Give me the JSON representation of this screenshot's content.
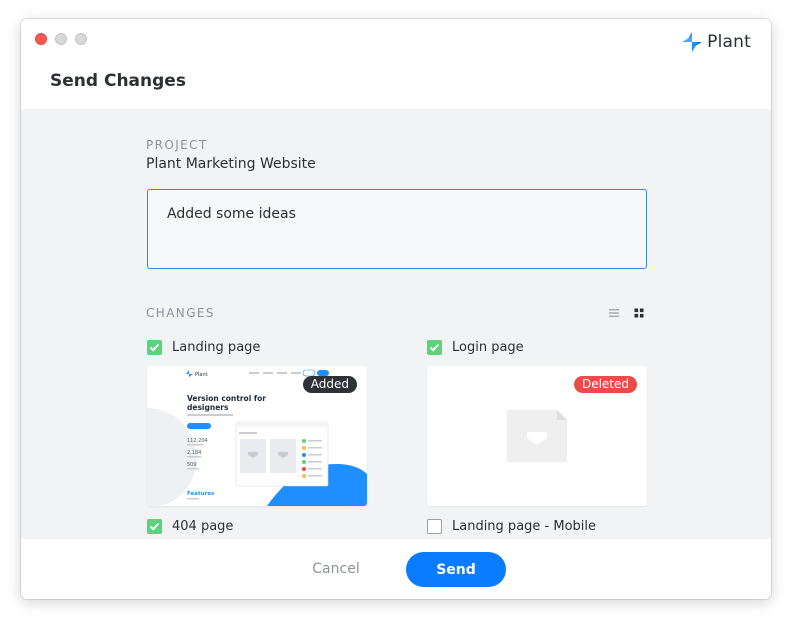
{
  "brand": {
    "name": "Plant",
    "logo_icon": "plant-logo-icon",
    "color": "#1f8fff"
  },
  "dialog": {
    "title": "Send Changes"
  },
  "project": {
    "label": "PROJECT",
    "name": "Plant Marketing Website"
  },
  "message": {
    "value": "Added some ideas",
    "placeholder": ""
  },
  "changes": {
    "label": "CHANGES",
    "view_modes": [
      {
        "icon": "list-view-icon",
        "active": false
      },
      {
        "icon": "grid-view-icon",
        "active": true
      }
    ],
    "items": [
      {
        "name": "Landing page",
        "checked": true,
        "badge": "Added",
        "badge_color": "#2f3337"
      },
      {
        "name": "Login page",
        "checked": true,
        "badge": "Deleted",
        "badge_color": "#ef4a4a"
      },
      {
        "name": "404 page",
        "checked": true
      },
      {
        "name": "Landing page - Mobile",
        "checked": false
      }
    ]
  },
  "thumbnail_landing": {
    "nav_brand": "Plant",
    "heading_line1": "Version control for",
    "heading_line2": "designers",
    "stat1": "112,204",
    "stat2": "2,184",
    "stat3": "509",
    "features": "Features"
  },
  "thumbnail_login": {
    "icon": "deleted-file-icon"
  },
  "footer": {
    "cancel_label": "Cancel",
    "send_label": "Send"
  },
  "colors": {
    "accent": "#0a7cff",
    "checkbox_on": "#5cd27b",
    "focus_border": "#3a86d9",
    "panel_bg": "#f2f3f5"
  }
}
